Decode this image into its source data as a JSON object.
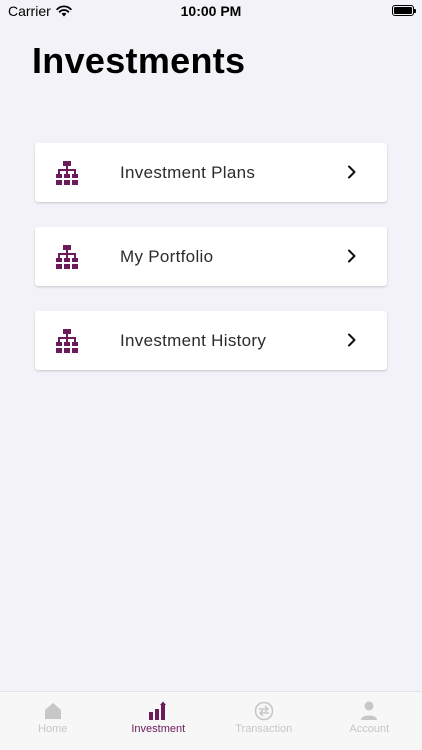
{
  "status_bar": {
    "carrier": "Carrier",
    "time": "10:00 PM"
  },
  "page": {
    "title": "Investments"
  },
  "menu": {
    "items": [
      {
        "label": "Investment Plans",
        "icon": "hierarchy-icon"
      },
      {
        "label": "My Portfolio",
        "icon": "hierarchy-icon"
      },
      {
        "label": "Investment History",
        "icon": "hierarchy-icon"
      }
    ]
  },
  "tab_bar": {
    "active": "Investment",
    "tabs": [
      {
        "label": "Home",
        "icon": "home-icon"
      },
      {
        "label": "Investment",
        "icon": "bar-chart-icon"
      },
      {
        "label": "Transaction",
        "icon": "exchange-icon"
      },
      {
        "label": "Account",
        "icon": "user-icon"
      }
    ]
  },
  "colors": {
    "accent": "#6b1a5a",
    "background": "#f3f2f8",
    "inactive_tab": "#c7c7c7"
  }
}
